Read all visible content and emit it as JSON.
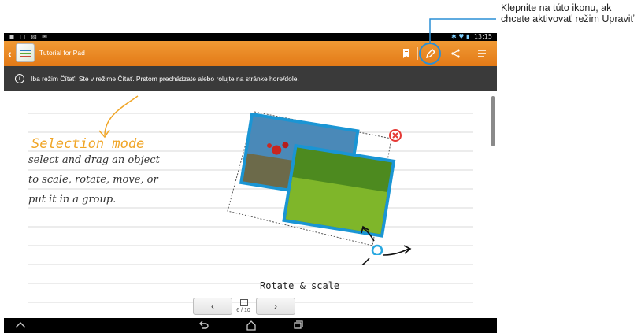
{
  "statusbar": {
    "left_icons": "▣ ▢ ▨ ✉",
    "signal": "✱ ♥ ▮",
    "time": "13:15"
  },
  "actionbar": {
    "back": "‹",
    "title": "Tutorial for Pad"
  },
  "infobar": {
    "icon": "i",
    "text": "Iba režim Čítať: Ste v režime Čítať. Prstom prechádzate alebo rolujte na stránke hore/dole."
  },
  "canvas": {
    "title": "Selection mode",
    "lines": [
      "select and drag an object",
      "to scale, rotate, move, or",
      "put it in a group."
    ],
    "rotate_label": "Rotate & scale"
  },
  "pager": {
    "prev": "‹",
    "next": "›",
    "current": "6",
    "separator": "/",
    "total": "10"
  },
  "callout": {
    "text": "Klepnite na túto ikonu, ak chcete aktivovať režim Upraviť"
  },
  "colors": {
    "accent": "#e8851f",
    "callout_line": "#2a8fd6",
    "title_handwriting": "#f0a526"
  },
  "icons": {
    "bookmark": "bookmark-icon",
    "edit": "edit-mode-icon",
    "share": "share-icon",
    "menu": "menu-icon",
    "home": "home-icon",
    "back_nav": "back-nav-icon",
    "recent": "recent-apps-icon",
    "hide": "hide-nav-icon"
  }
}
